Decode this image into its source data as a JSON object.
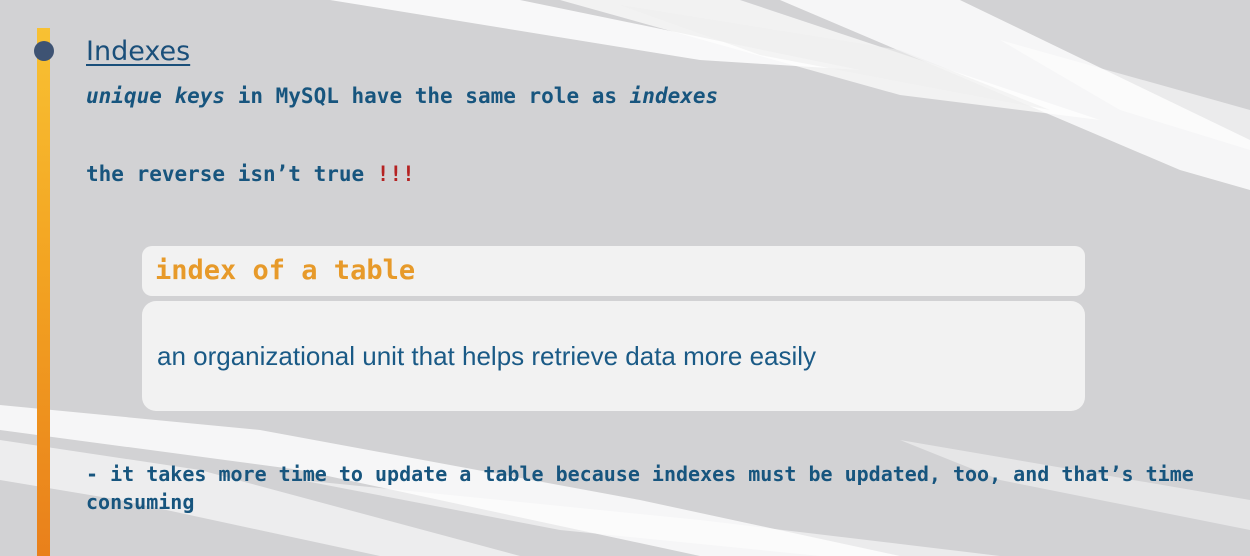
{
  "slide": {
    "heading": "Indexes",
    "line1": {
      "part1": "unique keys",
      "part2": " in MySQL have the same role as ",
      "part3": "indexes"
    },
    "line2": {
      "text": "the reverse isn’t true ",
      "emphasis": "!!!"
    },
    "definition": {
      "title": "index of a table",
      "body": "an organizational unit that helps retrieve data more easily"
    },
    "note": "- it takes more time to update a table because indexes must be updated, too, and that’s time consuming"
  },
  "colors": {
    "background": "#d2d2d4",
    "accent_orange": "#f3a422",
    "text_blue": "#17557e",
    "emphasis_red": "#b52222",
    "definition_title": "#e79a2a",
    "dot": "#3e5373"
  }
}
